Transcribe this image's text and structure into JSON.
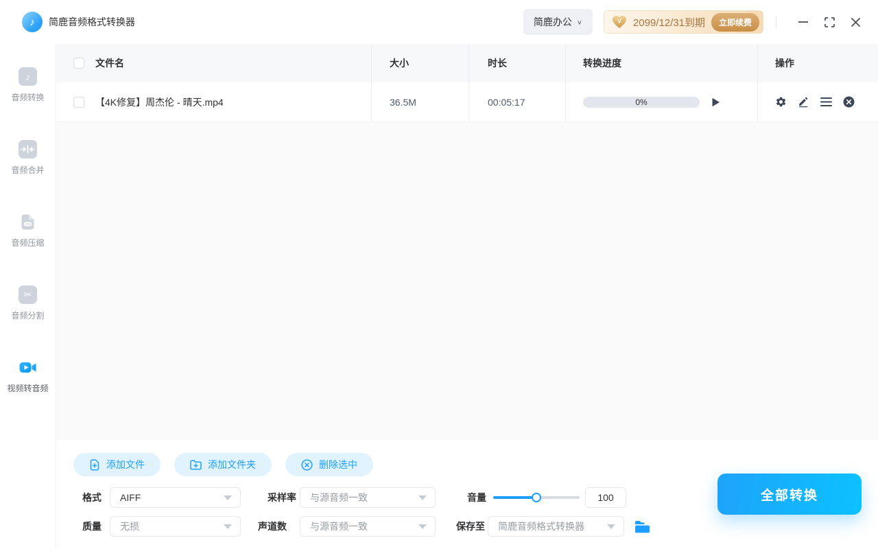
{
  "app": {
    "title": "简鹿音频格式转换器"
  },
  "topbar": {
    "suite_label": "简鹿办公",
    "vip_expiry": "2099/12/31到期",
    "renew_label": "立即续费"
  },
  "sidebar": {
    "items": [
      {
        "label": "音频转换",
        "icon": "audio-convert-icon",
        "active": false
      },
      {
        "label": "音频合并",
        "icon": "audio-merge-icon",
        "active": false
      },
      {
        "label": "音频压缩",
        "icon": "audio-compress-icon",
        "active": false
      },
      {
        "label": "音频分割",
        "icon": "audio-split-icon",
        "active": false
      },
      {
        "label": "视频转音频",
        "icon": "video-to-audio-icon",
        "active": true
      }
    ]
  },
  "table": {
    "headers": [
      "文件名",
      "大小",
      "时长",
      "转换进度",
      "操作"
    ],
    "rows": [
      {
        "name": "【4K修复】周杰伦 - 晴天.mp4",
        "size": "36.5M",
        "duration": "00:05:17",
        "progress_label": "0%",
        "progress_percent": 0
      }
    ]
  },
  "toolbar": {
    "add_file": "添加文件",
    "add_folder": "添加文件夹",
    "delete_selected": "删除选中"
  },
  "settings": {
    "format": {
      "label": "格式",
      "value": "AIFF"
    },
    "sample_rate": {
      "label": "采样率",
      "value": "与源音频一致"
    },
    "volume": {
      "label": "音量",
      "value": "100",
      "percent": 50
    },
    "quality": {
      "label": "质量",
      "value": "无损"
    },
    "channels": {
      "label": "声道数",
      "value": "与源音频一致"
    },
    "save_to": {
      "label": "保存至",
      "value": "简鹿音频格式转换器"
    }
  },
  "actions": {
    "convert_all": "全部转换"
  },
  "icons": {
    "music_note": "♪",
    "scissors": "✂",
    "chevron_down": "∨",
    "vip_letter": "V"
  },
  "colors": {
    "primary": "#1e9fff",
    "primary_gradient_start": "#1ea3fc",
    "primary_gradient_end": "#0cc1fe",
    "soft_button_bg": "#e1f3fe",
    "vip_text": "#aa7440",
    "vip_button_gold": "#c88e46",
    "progress_track": "#e3e6ec",
    "icon_slate": "#3d4757"
  }
}
